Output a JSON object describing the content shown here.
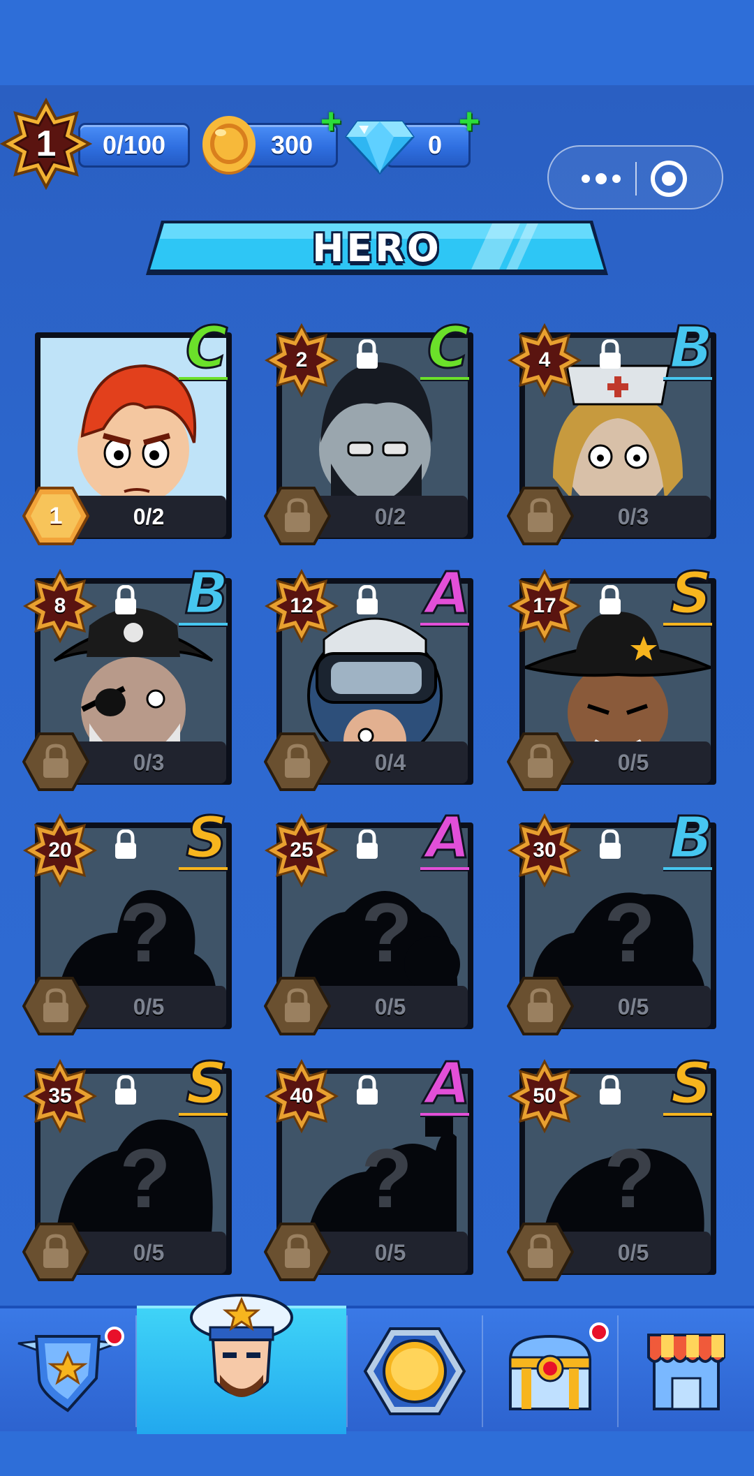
{
  "resources": {
    "level": "1",
    "xp": "0/100",
    "coins": "300",
    "gems": "0"
  },
  "header": {
    "title": "HERO"
  },
  "heroes": [
    {
      "level": "1",
      "progress": "0/2",
      "rank": "C",
      "rank_color": "#6be02a",
      "locked": false,
      "silhouette": false
    },
    {
      "level": "2",
      "progress": "0/2",
      "rank": "C",
      "rank_color": "#6be02a",
      "locked": true,
      "silhouette": false
    },
    {
      "level": "4",
      "progress": "0/3",
      "rank": "B",
      "rank_color": "#46c6f0",
      "locked": true,
      "silhouette": false
    },
    {
      "level": "8",
      "progress": "0/3",
      "rank": "B",
      "rank_color": "#46c6f0",
      "locked": true,
      "silhouette": false
    },
    {
      "level": "12",
      "progress": "0/4",
      "rank": "A",
      "rank_color": "#e24fd8",
      "locked": true,
      "silhouette": false
    },
    {
      "level": "17",
      "progress": "0/5",
      "rank": "S",
      "rank_color": "#f7b51e",
      "locked": true,
      "silhouette": false
    },
    {
      "level": "20",
      "progress": "0/5",
      "rank": "S",
      "rank_color": "#f7b51e",
      "locked": true,
      "silhouette": true
    },
    {
      "level": "25",
      "progress": "0/5",
      "rank": "A",
      "rank_color": "#e24fd8",
      "locked": true,
      "silhouette": true
    },
    {
      "level": "30",
      "progress": "0/5",
      "rank": "B",
      "rank_color": "#46c6f0",
      "locked": true,
      "silhouette": true
    },
    {
      "level": "35",
      "progress": "0/5",
      "rank": "S",
      "rank_color": "#f7b51e",
      "locked": true,
      "silhouette": true
    },
    {
      "level": "40",
      "progress": "0/5",
      "rank": "A",
      "rank_color": "#e24fd8",
      "locked": true,
      "silhouette": true
    },
    {
      "level": "50",
      "progress": "0/5",
      "rank": "S",
      "rank_color": "#f7b51e",
      "locked": true,
      "silhouette": true
    }
  ],
  "nav": [
    {
      "icon": "shield-star-icon",
      "badge": true
    },
    {
      "icon": "hero-captain-icon",
      "active": true
    },
    {
      "icon": "gold-coin-icon"
    },
    {
      "icon": "treasure-chest-icon",
      "badge": true
    },
    {
      "icon": "shop-icon"
    }
  ],
  "portrait_icons": [
    "red-hair-hero",
    "bearded-hero",
    "nurse-hero",
    "pirate-hero",
    "goggles-hero",
    "cowboy-hero"
  ]
}
